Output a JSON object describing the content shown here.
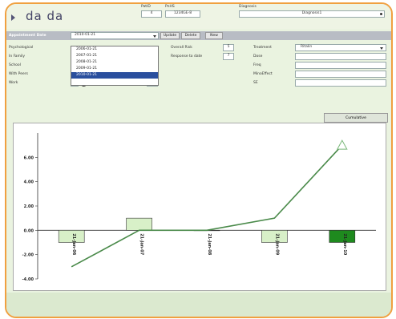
{
  "header": {
    "title": "da da",
    "patid_label": "PatID",
    "patid_value": "4",
    "pnhs_label": "PnHS",
    "pnhs_value": "1234GE-8",
    "diagnosis_label": "Diagnosis",
    "diagnosis_value": "Diagnosis1"
  },
  "toolbar": {
    "appointment_label": "Appointment Date",
    "appointment_value": "2010-01-21",
    "update_label": "Update",
    "delete_label": "Delete",
    "new_label": "New"
  },
  "dropdown": {
    "options": [
      "2006-01-21",
      "2007-01-21",
      "2008-01-21",
      "2009-01-21",
      "2010-01-21"
    ],
    "selected": "2010-01-21"
  },
  "left_fields": [
    {
      "label": "Psychological",
      "value": ""
    },
    {
      "label": "In Family",
      "value": ""
    },
    {
      "label": "School",
      "value": ""
    },
    {
      "label": "With Peers",
      "value": "1"
    },
    {
      "label": "Work",
      "value": "1"
    }
  ],
  "middle_fields": {
    "overall_risk_label": "Overall Risk",
    "overall_risk_value": "5",
    "response_label": "Response to date",
    "response_value": "7"
  },
  "right_fields": [
    {
      "label": "Treatment",
      "value": "Ritalin"
    },
    {
      "label": "Dose",
      "value": ""
    },
    {
      "label": "Freq",
      "value": ""
    },
    {
      "label": "MinoEffect",
      "value": ""
    },
    {
      "label": "SE",
      "value": ""
    }
  ],
  "cumulative_label": "Cumulative",
  "chart_data": {
    "type": "bar",
    "categories": [
      "21-Jan-06",
      "21-Jan-07",
      "21-Jan-08",
      "21-Jan-09",
      "21-Jan-10"
    ],
    "values": [
      -1,
      1,
      0,
      -1,
      -1
    ],
    "line": [
      -3,
      0,
      0,
      1,
      7
    ],
    "yticks": [
      "6.00",
      "4.00",
      "2.00",
      "0.00",
      "-2.00",
      "-4.00"
    ],
    "ylim": [
      -4,
      8
    ],
    "colors": {
      "bar": "#d8f0c8",
      "bar_last": "#1e8a1e",
      "line": "#4a8a4a"
    }
  }
}
